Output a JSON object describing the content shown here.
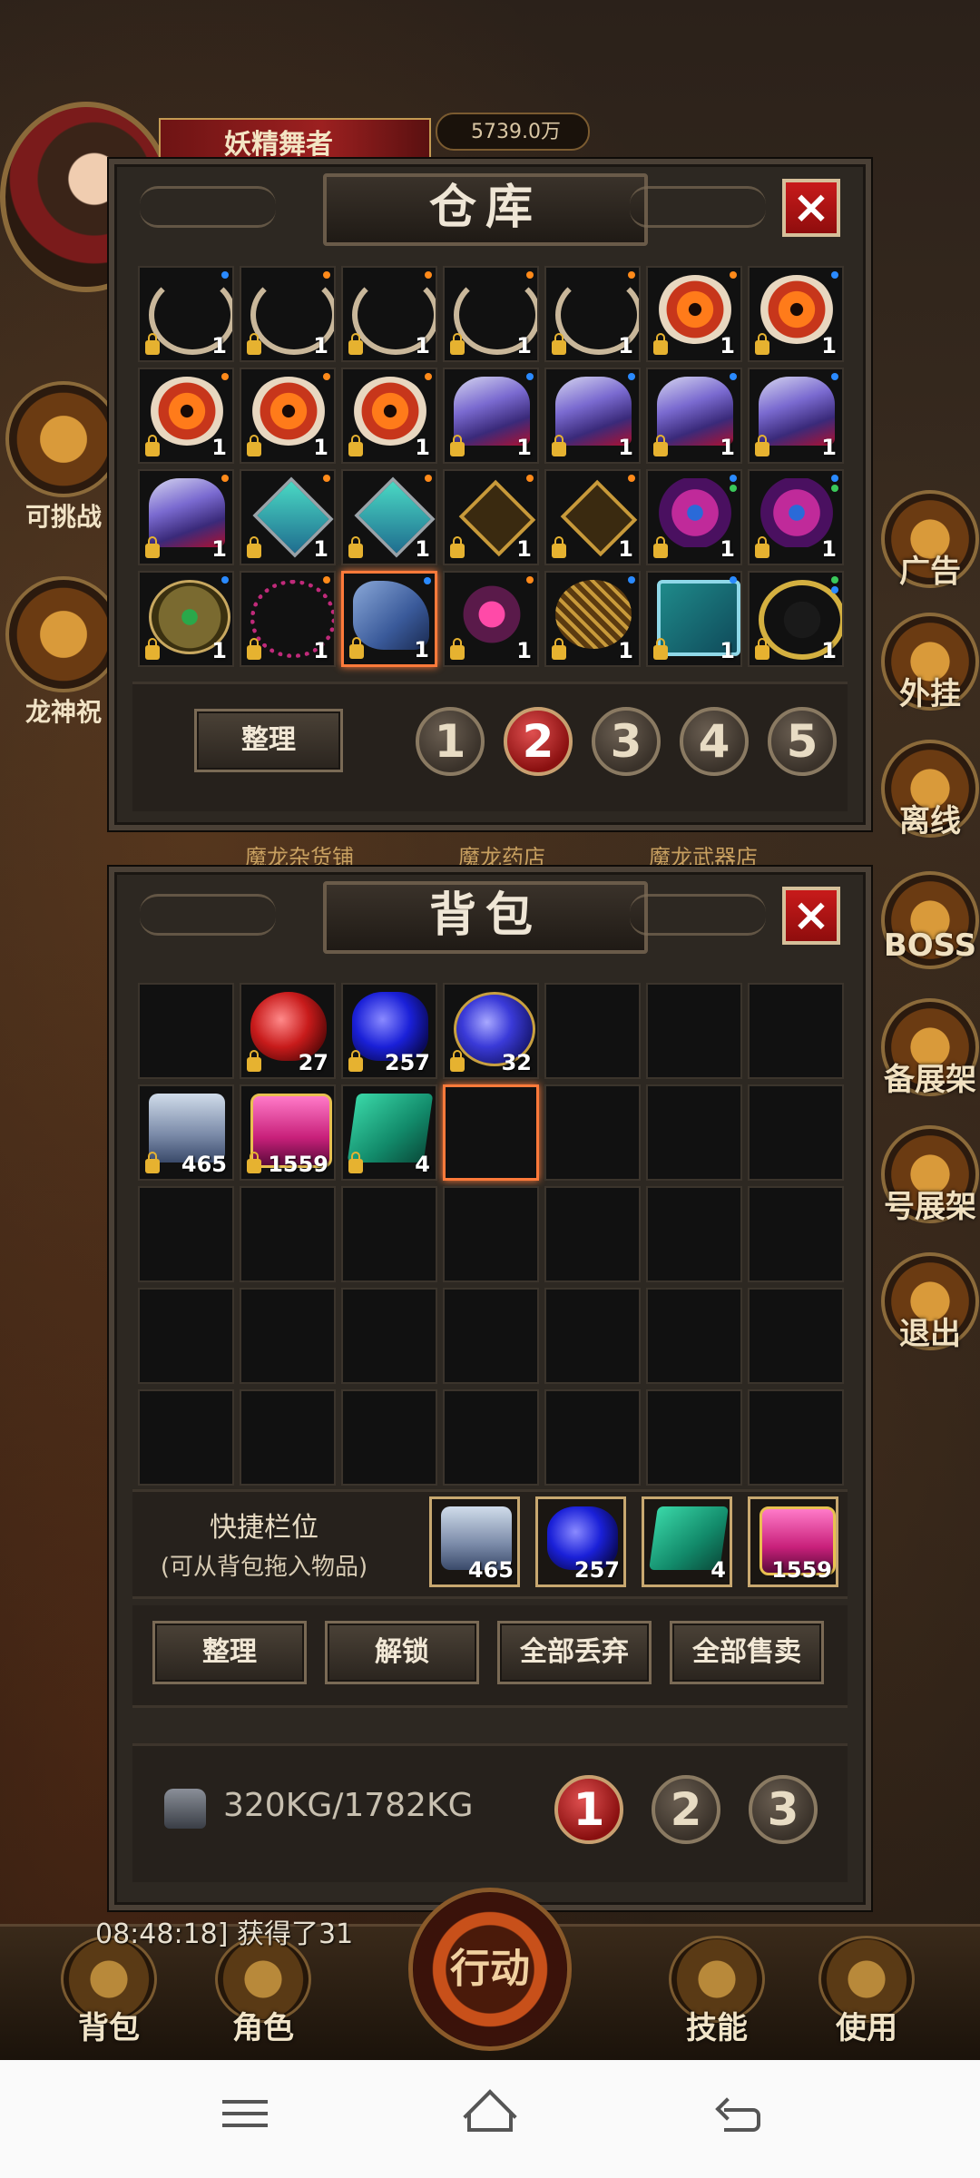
{
  "hud": {
    "player_name": "妖精舞者",
    "gold": "5739.0万",
    "left_side": [
      {
        "label": "可挑战",
        "icon": "boss-challenge-icon"
      },
      {
        "label": "龙神祝",
        "icon": "dragon-blessing-icon"
      }
    ],
    "right_side": [
      {
        "label": "广告"
      },
      {
        "label": "外挂"
      },
      {
        "label": "离线"
      },
      {
        "label": "BOSS"
      },
      {
        "label": "备展架"
      },
      {
        "label": "号展架"
      },
      {
        "label": "退出"
      }
    ],
    "shop_tabs": [
      "魔龙杂货铺",
      "魔龙药店",
      "魔龙武器店"
    ],
    "log_line": "08:48:18] 获得了31"
  },
  "warehouse": {
    "title": "仓库",
    "close_label": "×",
    "items": [
      {
        "type": "neck",
        "qty": "1",
        "dots": [
          "#2a8aff"
        ]
      },
      {
        "type": "neck",
        "qty": "1",
        "dots": [
          "#ff8a1a"
        ]
      },
      {
        "type": "neck",
        "qty": "1",
        "dots": [
          "#ff8a1a"
        ]
      },
      {
        "type": "neck",
        "qty": "1",
        "dots": [
          "#ff8a1a"
        ]
      },
      {
        "type": "neck",
        "qty": "1",
        "dots": [
          "#ff8a1a"
        ]
      },
      {
        "type": "eye",
        "qty": "1",
        "dots": [
          "#ff8a1a"
        ]
      },
      {
        "type": "eye",
        "qty": "1",
        "dots": [
          "#2a8aff"
        ]
      },
      {
        "type": "eye",
        "qty": "1",
        "dots": [
          "#ff8a1a"
        ]
      },
      {
        "type": "eye",
        "qty": "1",
        "dots": [
          "#ff8a1a"
        ]
      },
      {
        "type": "eye",
        "qty": "1",
        "dots": [
          "#ff8a1a"
        ]
      },
      {
        "type": "helm",
        "qty": "1",
        "dots": [
          "#2a8aff"
        ]
      },
      {
        "type": "helm",
        "qty": "1",
        "dots": [
          "#2a8aff"
        ]
      },
      {
        "type": "helm",
        "qty": "1",
        "dots": [
          "#2a8aff"
        ]
      },
      {
        "type": "helm",
        "qty": "1",
        "dots": [
          "#2a8aff"
        ]
      },
      {
        "type": "helm",
        "qty": "1",
        "dots": [
          "#ff8a1a"
        ]
      },
      {
        "type": "gem",
        "qty": "1",
        "dots": [
          "#ff8a1a"
        ]
      },
      {
        "type": "gem",
        "qty": "1",
        "dots": [
          "#ff8a1a"
        ]
      },
      {
        "type": "gold",
        "qty": "1",
        "dots": [
          "#ff8a1a"
        ]
      },
      {
        "type": "gold",
        "qty": "1",
        "dots": [
          "#ff8a1a"
        ]
      },
      {
        "type": "purple",
        "qty": "1",
        "dots": [
          "#2a8aff",
          "#3ac85a"
        ]
      },
      {
        "type": "purple",
        "qty": "1",
        "dots": [
          "#2a8aff",
          "#3ac85a"
        ]
      },
      {
        "type": "round",
        "qty": "1",
        "dots": [
          "#2a8aff"
        ]
      },
      {
        "type": "chain",
        "qty": "1",
        "dots": [
          "#ff8a1a"
        ]
      },
      {
        "type": "horse",
        "qty": "1",
        "dots": [
          "#2a8aff"
        ],
        "selected": true
      },
      {
        "type": "drop",
        "qty": "1",
        "dots": [
          "#ff8a1a"
        ]
      },
      {
        "type": "claw",
        "qty": "1",
        "dots": [
          "#2a8aff"
        ]
      },
      {
        "type": "book",
        "qty": "1",
        "dots": [
          "#2a8aff"
        ]
      },
      {
        "type": "ring",
        "qty": "1",
        "dots": [
          "#3ac85a",
          "#2a8aff"
        ]
      }
    ],
    "sort_label": "整理",
    "pages": [
      "1",
      "2",
      "3",
      "4",
      "5"
    ],
    "active_page": "2"
  },
  "bag": {
    "title": "背包",
    "close_label": "×",
    "items": [
      {
        "type": "empty"
      },
      {
        "type": "redpot",
        "qty": "27"
      },
      {
        "type": "bluepot",
        "qty": "257"
      },
      {
        "type": "bluepot2",
        "qty": "32"
      },
      {
        "type": "empty"
      },
      {
        "type": "empty"
      },
      {
        "type": "empty"
      },
      {
        "type": "scroll",
        "qty": "465"
      },
      {
        "type": "pinkscroll",
        "qty": "1559"
      },
      {
        "type": "greenbook",
        "qty": "4"
      },
      {
        "type": "empty",
        "selected": true
      },
      {
        "type": "empty"
      },
      {
        "type": "empty"
      },
      {
        "type": "empty"
      },
      {
        "type": "empty"
      },
      {
        "type": "empty"
      },
      {
        "type": "empty"
      },
      {
        "type": "empty"
      },
      {
        "type": "empty"
      },
      {
        "type": "empty"
      },
      {
        "type": "empty"
      },
      {
        "type": "empty"
      },
      {
        "type": "empty"
      },
      {
        "type": "empty"
      },
      {
        "type": "empty"
      },
      {
        "type": "empty"
      },
      {
        "type": "empty"
      },
      {
        "type": "empty"
      },
      {
        "type": "empty"
      },
      {
        "type": "empty"
      },
      {
        "type": "empty"
      },
      {
        "type": "empty"
      },
      {
        "type": "empty"
      },
      {
        "type": "empty"
      },
      {
        "type": "empty"
      }
    ],
    "quickbar_title": "快捷栏位",
    "quickbar_hint": "(可从背包拖入物品)",
    "quickbar": [
      {
        "type": "scroll",
        "qty": "465"
      },
      {
        "type": "bluepot",
        "qty": "257"
      },
      {
        "type": "greenbook",
        "qty": "4"
      },
      {
        "type": "pinkscroll",
        "qty": "1559"
      }
    ],
    "buttons": {
      "sort": "整理",
      "unlock": "解锁",
      "discard_all": "全部丢弃",
      "sell_all": "全部售卖"
    },
    "weight": "320KG/1782KG",
    "pages": [
      "1",
      "2",
      "3"
    ],
    "active_page": "1"
  },
  "bottom_bar": {
    "bag": "背包",
    "character": "角色",
    "action": "行动",
    "skills": "技能",
    "use": "使用"
  }
}
